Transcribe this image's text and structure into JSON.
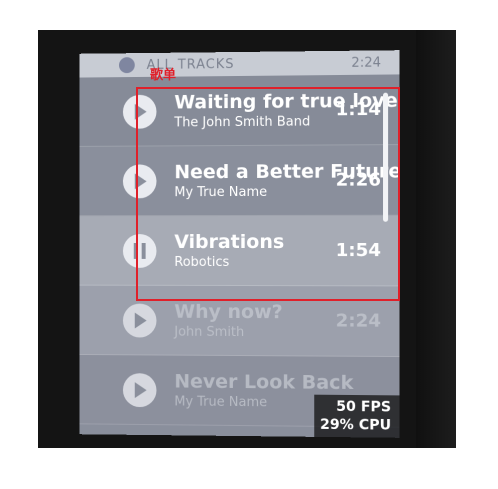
{
  "header": {
    "title": "ALL TRACKS",
    "time": "2:24"
  },
  "tracks": [
    {
      "title": "Waiting for true love",
      "artist": "The John Smith Band",
      "duration": "1:14",
      "state": "play"
    },
    {
      "title": "Need a Better Future",
      "artist": "My True Name",
      "duration": "2:26",
      "state": "play"
    },
    {
      "title": "Vibrations",
      "artist": "Robotics",
      "duration": "1:54",
      "state": "pause"
    },
    {
      "title": "Why now?",
      "artist": "John Smith",
      "duration": "2:24",
      "state": "play"
    },
    {
      "title": "Never Look Back",
      "artist": "My True Name",
      "duration": "",
      "state": "play"
    }
  ],
  "perf": {
    "fps": "50 FPS",
    "cpu": "29% CPU"
  },
  "annotation": {
    "label": "歌单",
    "color": "#e0202a"
  },
  "colors": {
    "screen": "#8a8f9c",
    "highlight_row": "#a7abb5"
  },
  "icons": {
    "play": "play-icon",
    "pause": "pause-icon"
  }
}
